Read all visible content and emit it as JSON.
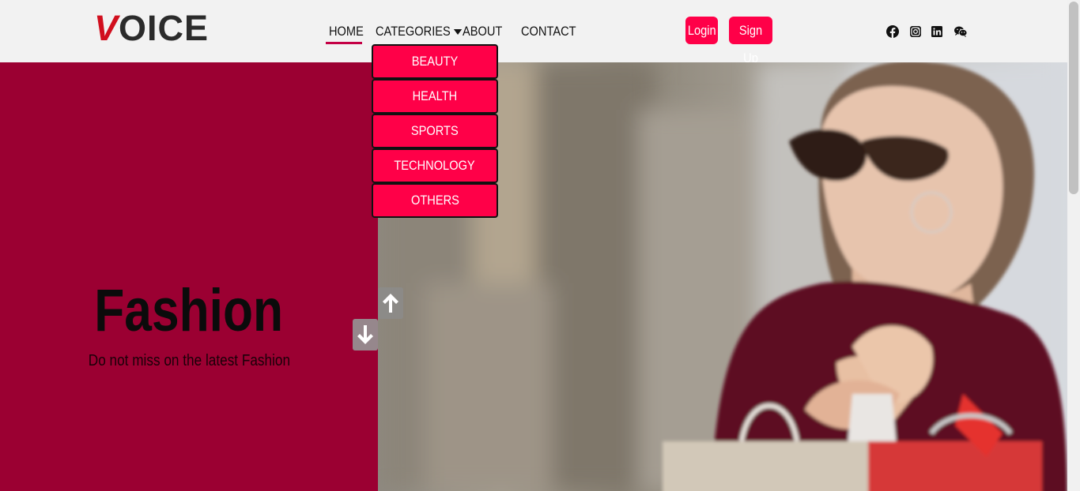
{
  "header": {
    "logo_first": "V",
    "logo_rest": "OICE",
    "nav": {
      "home": "HOME",
      "categories": "CATEGORIES",
      "about": "ABOUT",
      "contact": "CONTACT"
    },
    "login_label": "Login",
    "signup_label": "Sign Up",
    "social_icons": [
      "facebook-icon",
      "instagram-icon",
      "linkedin-icon",
      "wechat-icon"
    ]
  },
  "dropdown": {
    "items": [
      "BEAUTY",
      "HEALTH",
      "SPORTS",
      "TECHNOLOGY",
      "OTHERS"
    ]
  },
  "hero": {
    "title": "Fashion",
    "subtitle": "Do not miss on the latest Fashion"
  },
  "colors": {
    "accent": "#ff0048",
    "hero_panel": "#9b0032",
    "active_underline": "#c40045"
  }
}
